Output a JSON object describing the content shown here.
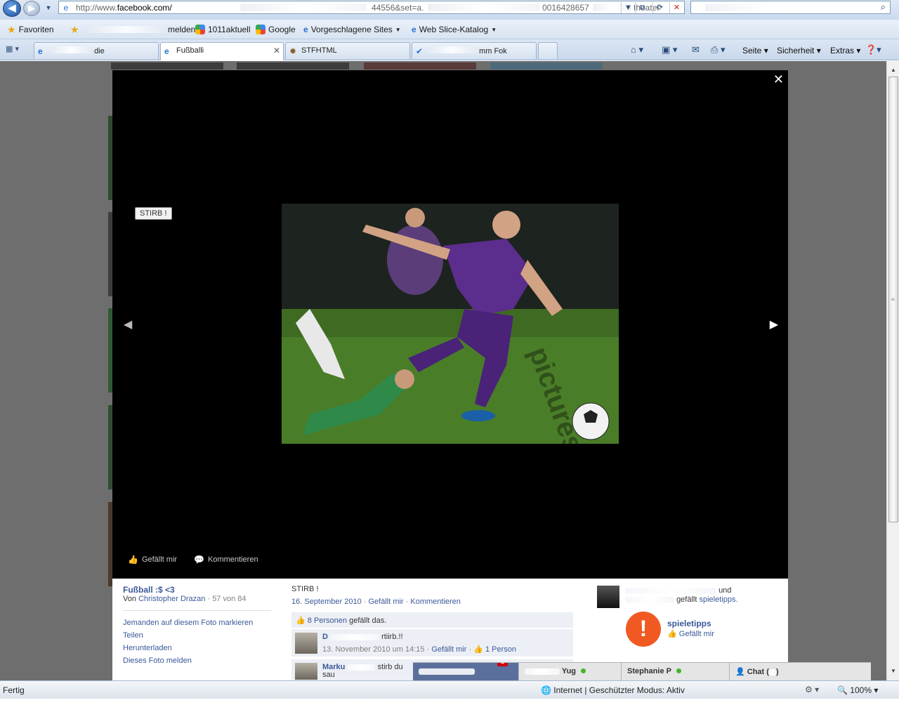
{
  "browser": {
    "url_prefix": "http://www.",
    "url_domain": "facebook.com/",
    "url_mid": "44556&set=a.",
    "url_tail": "0016428657",
    "url_end": "theater",
    "favorites_label": "Favoriten",
    "fav_links": [
      "1011aktuell",
      "Google",
      "Vorgeschlagene Sites",
      "Web Slice-Katalog"
    ],
    "fav_misc": "melden",
    "tabs": [
      "die",
      "Fußballi",
      "STFHTML",
      "mm Fok"
    ],
    "commands": [
      "Seite",
      "Sicherheit",
      "Extras"
    ],
    "status_left": "Fertig",
    "status_zone": "Internet | Geschützter Modus: Aktiv",
    "zoom": "100%"
  },
  "theater": {
    "close_glyph": "✕",
    "tag_label": "STIRB !",
    "prev_glyph": "◀",
    "next_glyph": "▶",
    "like_action": "Gefällt mir",
    "comment_action": "Kommentieren"
  },
  "info": {
    "album_title": "Fußball :$ <3",
    "by_prefix": "Von",
    "owner": "Christopher Drazan",
    "count": "· 57 von 84",
    "links": [
      "Jemanden auf diesem Foto markieren",
      "Teilen",
      "Herunterladen",
      "Dieses Foto melden"
    ],
    "caption": "STIRB !",
    "date": "16. September 2010",
    "like_link": "Gefällt mir",
    "comment_link": "Kommentieren",
    "likes_count": "8 Personen",
    "likes_suffix": "gefällt das.",
    "comments": [
      {
        "name": "D",
        "text": "rtiirb.!!",
        "time": "13. November 2010 um 14:15",
        "like": "Gefällt mir",
        "likes": "1 Person"
      },
      {
        "name": "Marku",
        "text": "stirb du",
        "text2": "sau"
      }
    ]
  },
  "ad": {
    "line_end": "und",
    "line2": "gefällt",
    "page_link": "spieletipps.",
    "name": "spieletipps",
    "like": "Gefällt mir"
  },
  "chat": {
    "badge": "1",
    "contact1": "Yug",
    "contact2": "Stephanie P",
    "label": "Chat (",
    "label_end": ")"
  }
}
